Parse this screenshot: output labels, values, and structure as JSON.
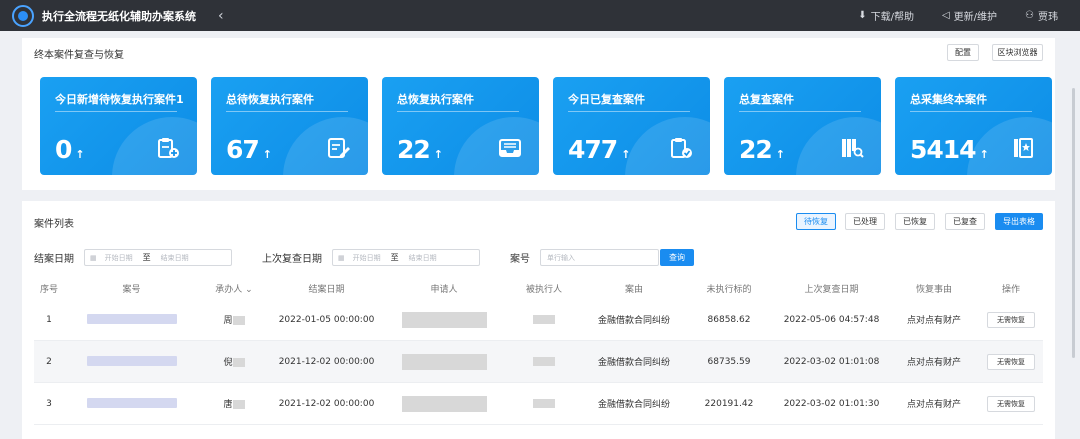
{
  "header": {
    "app_title": "执行全流程无纸化辅助办案系统",
    "collapse_glyph": "‹",
    "actions": [
      {
        "label": "下载/帮助",
        "icon": "download-icon",
        "glyph": "⬇"
      },
      {
        "label": "更新/维护",
        "icon": "speaker-icon",
        "glyph": "◁"
      },
      {
        "label": "贾玮",
        "icon": "user-icon",
        "glyph": "⚇"
      }
    ]
  },
  "overview": {
    "title": "终本案件复查与恢复",
    "buttons": [
      "配置",
      "区块浏览器"
    ],
    "cards": [
      {
        "label": "今日新增待恢复执行案件1",
        "value": "0",
        "arrow": "↑",
        "icon": "clipboard-plus-icon"
      },
      {
        "label": "总待恢复执行案件",
        "value": "67",
        "arrow": "↑",
        "icon": "edit-document-icon"
      },
      {
        "label": "总恢复执行案件",
        "value": "22",
        "arrow": "↑",
        "icon": "inbox-tray-icon"
      },
      {
        "label": "今日已复查案件",
        "value": "477",
        "arrow": "↑",
        "icon": "clipboard-check-icon"
      },
      {
        "label": "总复查案件",
        "value": "22",
        "arrow": "↑",
        "icon": "books-search-icon"
      },
      {
        "label": "总采集终本案件",
        "value": "5414",
        "arrow": "↑",
        "icon": "book-star-icon"
      }
    ]
  },
  "case_list": {
    "title": "案件列表",
    "tabs": [
      "待恢复",
      "已处理",
      "已恢复",
      "已复查"
    ],
    "export_label": "导出表格",
    "filters": {
      "close_date_label": "结案日期",
      "last_review_label": "上次复查日期",
      "start_placeholder": "开始日期",
      "to": "至",
      "end_placeholder": "结束日期",
      "case_no_label": "案号",
      "case_no_placeholder": "单行输入",
      "query_label": "查询"
    },
    "columns": [
      "序号",
      "案号",
      "承办人",
      "结案日期",
      "申请人",
      "被执行人",
      "案由",
      "未执行标的",
      "上次复查日期",
      "恢复事由",
      "操作"
    ],
    "rows": [
      {
        "no": "1",
        "judge": "周",
        "close_date": "2022-01-05 00:00:00",
        "cause": "金融借款合同纠纷",
        "amount": "86858.62",
        "last_review": "2022-05-06 04:57:48",
        "reason": "点对点有财产",
        "action": "无需恢复"
      },
      {
        "no": "2",
        "judge": "倪",
        "close_date": "2021-12-02 00:00:00",
        "cause": "金融借款合同纠纷",
        "amount": "68735.59",
        "last_review": "2022-03-02 01:01:08",
        "reason": "点对点有财产",
        "action": "无需恢复"
      },
      {
        "no": "3",
        "judge": "唐",
        "close_date": "2021-12-02 00:00:00",
        "cause": "金融借款合同纠纷",
        "amount": "220191.42",
        "last_review": "2022-03-02 01:01:30",
        "reason": "点对点有财产",
        "action": "无需恢复"
      }
    ]
  }
}
